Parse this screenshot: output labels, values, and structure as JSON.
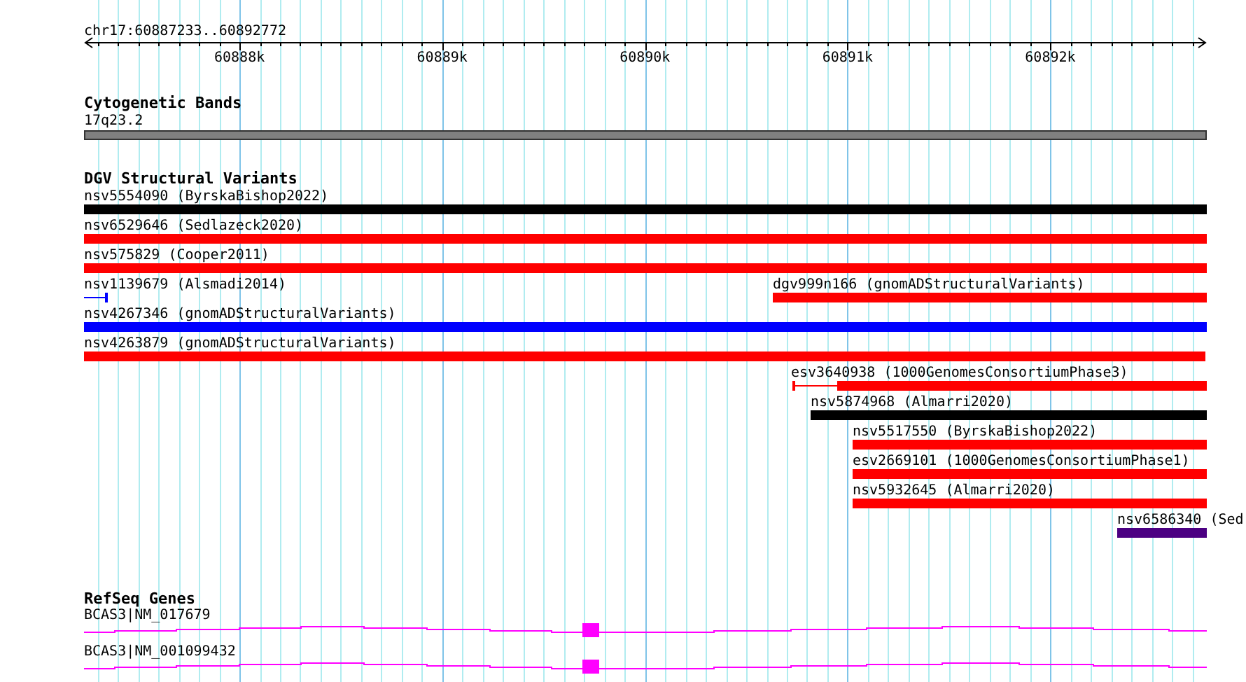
{
  "ruler": {
    "location": "chr17:60887233..60892772",
    "ticks": [
      "60888k",
      "60889k",
      "60890k",
      "60891k",
      "60892k"
    ]
  },
  "tracks": [
    {
      "title": "Cytogenetic Bands",
      "features": [
        {
          "label": "17q23.2",
          "kind": "band",
          "color": "#808080"
        }
      ]
    },
    {
      "title": "DGV Structural Variants",
      "features": [
        {
          "label": "nsv5554090 (ByrskaBishop2022)",
          "kind": "bar",
          "color": "#000000"
        },
        {
          "label": "nsv6529646 (Sedlazeck2020)",
          "kind": "bar",
          "color": "#ff0000"
        },
        {
          "label": "nsv575829 (Cooper2011)",
          "kind": "bar",
          "color": "#ff0000"
        },
        {
          "label": "nsv1139679 (Alsmadi2014)",
          "kind": "thin",
          "color": "#0000ff"
        },
        {
          "label": "nsv4267346 (gnomADStructuralVariants)",
          "kind": "bar",
          "color": "#0000ff"
        },
        {
          "label": "nsv4263879 (gnomADStructuralVariants)",
          "kind": "bar",
          "color": "#ff0000"
        },
        {
          "label": "dgv999n166 (gnomADStructuralVariants)",
          "kind": "bar",
          "color": "#ff0000"
        },
        {
          "label": "esv3640938 (1000GenomesConsortiumPhase3)",
          "kind": "gapped",
          "color": "#ff0000"
        },
        {
          "label": "nsv5874968 (Almarri2020)",
          "kind": "bar",
          "color": "#000000"
        },
        {
          "label": "nsv5517550 (ByrskaBishop2022)",
          "kind": "bar",
          "color": "#ff0000"
        },
        {
          "label": "esv2669101 (1000GenomesConsortiumPhase1)",
          "kind": "bar",
          "color": "#ff0000"
        },
        {
          "label": "nsv5932645 (Almarri2020)",
          "kind": "bar",
          "color": "#ff0000"
        },
        {
          "label": "nsv6586340 (Sed",
          "kind": "bar",
          "color": "#4b0082"
        }
      ]
    },
    {
      "title": "RefSeq Genes",
      "features": [
        {
          "label": "BCAS3|NM_017679",
          "kind": "transcript",
          "color": "#ff00ff"
        },
        {
          "label": "BCAS3|NM_001099432",
          "kind": "transcript",
          "color": "#ff00ff"
        }
      ]
    }
  ]
}
